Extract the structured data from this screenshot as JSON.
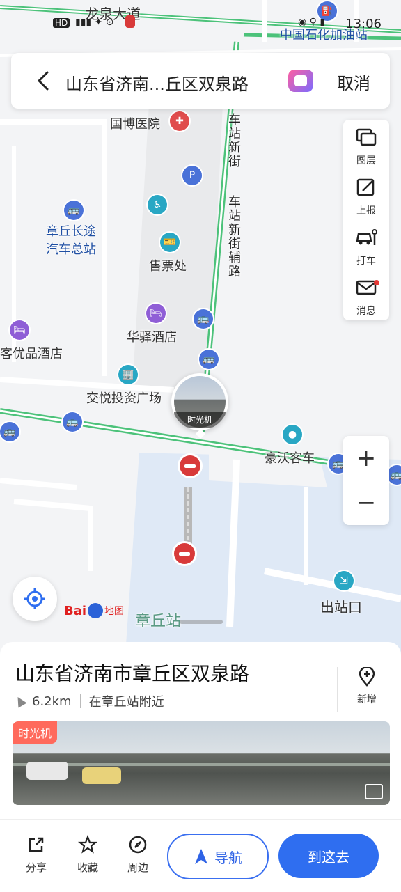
{
  "status": {
    "time": "13:06",
    "network": "HD"
  },
  "map": {
    "roads": {
      "top": "龙泉大道",
      "vertical_1": "车站新街",
      "vertical_2": "车站新街辅路"
    },
    "labels": {
      "gas_station": "中国石化加油站",
      "hospital": "国博医院",
      "bus_station": "章丘长途\n汽车总站",
      "ticket_office": "售票处",
      "hotel_1": "华驿酒店",
      "hotel_2": "客优品酒店",
      "plaza": "交悦投资广场",
      "haowo": "豪沃客车",
      "exit": "出站口",
      "station": "章丘站",
      "baidu": "地图"
    },
    "street_view_caption": "时光机"
  },
  "search": {
    "query": "山东省济南...丘区双泉路",
    "cancel": "取消"
  },
  "tools": [
    {
      "label": "图层",
      "icon": "layers-icon"
    },
    {
      "label": "上报",
      "icon": "report-icon"
    },
    {
      "label": "打车",
      "icon": "taxi-icon"
    },
    {
      "label": "消息",
      "icon": "message-icon"
    }
  ],
  "zoom": {
    "in": "+",
    "out": "−"
  },
  "card": {
    "title": "山东省济南市章丘区双泉路",
    "distance": "6.2km",
    "nearby": "在章丘站附近",
    "add_label": "新增",
    "photo_tag": "时光机"
  },
  "bottom": {
    "share": "分享",
    "favorite": "收藏",
    "nearby": "周边",
    "navigate": "导航",
    "go": "到这去"
  },
  "colors": {
    "accent": "#2f6ef0",
    "road_green": "#4cc27a",
    "water": "#dfe9f6"
  }
}
